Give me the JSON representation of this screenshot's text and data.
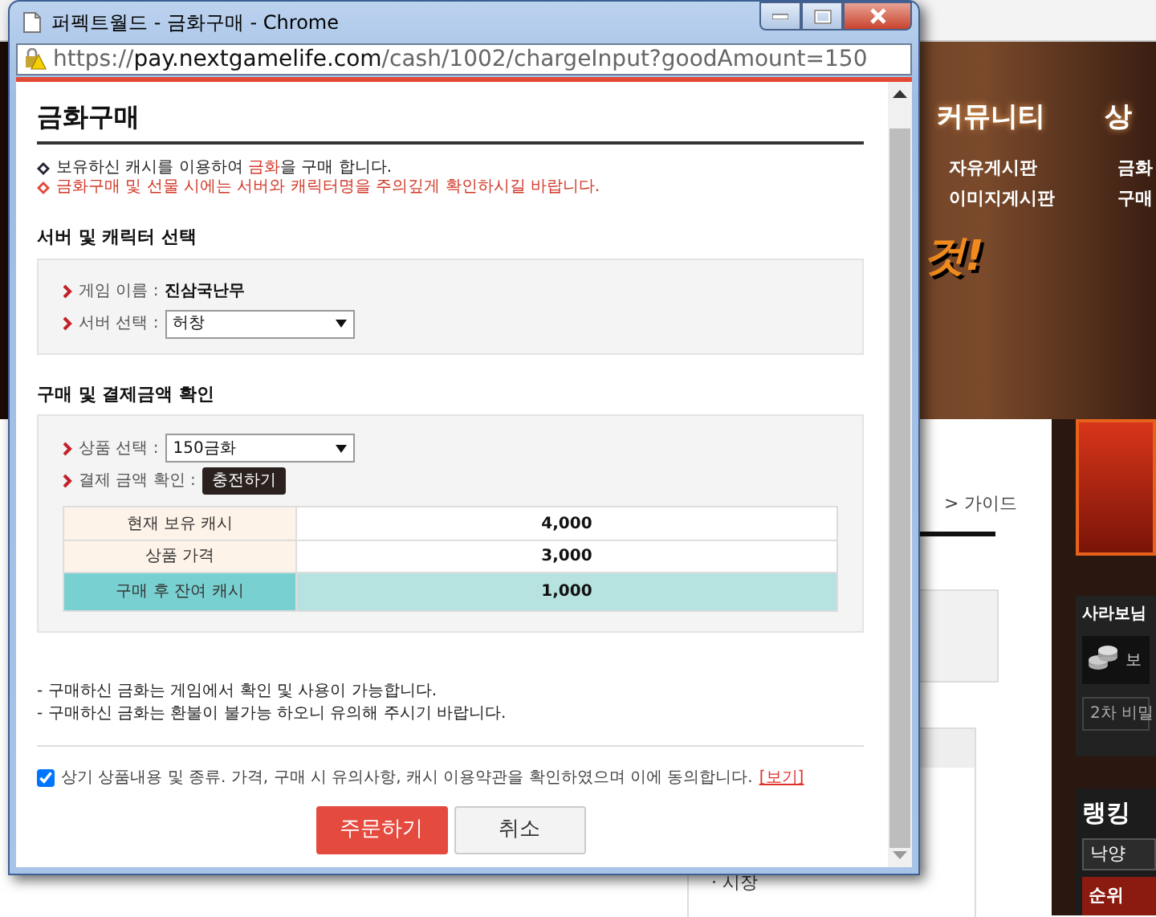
{
  "background_page": {
    "banner": {
      "promo_text": "것!",
      "nav": [
        {
          "title": "커뮤니티",
          "items": [
            "자유게시판",
            "이미지게시판"
          ]
        },
        {
          "title": "상",
          "items": [
            "금화",
            "구매"
          ]
        }
      ]
    },
    "breadcrumb": "> 가이드",
    "list_items": [
      "· 시장"
    ],
    "sidebar": {
      "user": "사라보님",
      "balance_label": "보",
      "password_button": "2차 비밀",
      "ranking_title": "랭킹",
      "ranking_select": "낙양",
      "ranking_header": "순위"
    }
  },
  "window": {
    "title": "퍼펙트월드 - 금화구매 - Chrome",
    "url": {
      "scheme": "https://",
      "host": "pay.nextgamelife.com",
      "path": "/cash/1002/chargeInput?goodAmount=150"
    }
  },
  "page": {
    "heading": "금화구매",
    "notices": [
      {
        "kind": "info",
        "parts": [
          {
            "text": "보유하신 캐시를 이용하여 ",
            "highlight": false
          },
          {
            "text": "금화",
            "highlight": true
          },
          {
            "text": "을 구매 합니다.",
            "highlight": false
          }
        ]
      },
      {
        "kind": "warning",
        "text": "금화구매 및 선물 시에는 서버와 캐릭터명을 주의깊게 확인하시길 바랍니다."
      }
    ],
    "sections": [
      {
        "title": "서버 및 캐릭터 선택",
        "fields": [
          {
            "kind": "text",
            "label": "게임 이름 :",
            "value": "진삼국난무"
          },
          {
            "kind": "select",
            "label": "서버 선택 :",
            "value": "허창"
          }
        ]
      },
      {
        "title": "구매 및 결제금액 확인",
        "fields": [
          {
            "kind": "select",
            "label": "상품 선택 :",
            "value": "150금화"
          },
          {
            "kind": "button",
            "label": "결제 금액 확인 :",
            "value": "충전하기"
          }
        ],
        "table": [
          {
            "kind": "normal",
            "label": "현재 보유 캐시",
            "value": "4,000"
          },
          {
            "kind": "normal",
            "label": "상품 가격",
            "value": "3,000"
          },
          {
            "kind": "result",
            "label": "구매 후 잔여 캐시",
            "value": "1,000"
          }
        ]
      }
    ],
    "notes": [
      "- 구매하신 금화는 게임에서 확인 및 사용이 가능합니다.",
      "- 구매하신 금화는 환불이 불가능 하오니 유의해 주시기 바랍니다."
    ],
    "agreement": {
      "checked": true,
      "text": "상기 상품내용 및 종류. 가격, 구매 시 유의사항, 캐시 이용약관을 확인하였으며 이에 동의합니다.",
      "link": "[보기]"
    },
    "buttons": [
      {
        "kind": "primary",
        "label": "주문하기"
      },
      {
        "kind": "secondary",
        "label": "취소"
      }
    ]
  }
}
